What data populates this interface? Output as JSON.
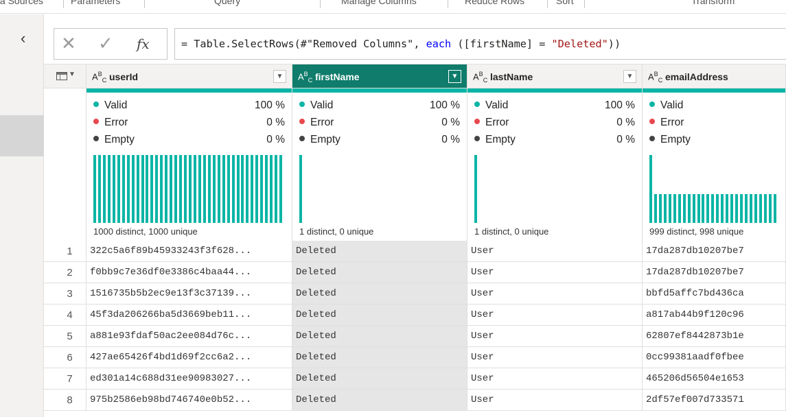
{
  "ribbon": {
    "groups": [
      "ta Sources",
      "Parameters",
      "Query",
      "Manage Columns",
      "Reduce Rows",
      "Sort",
      "Transform"
    ]
  },
  "nav": {
    "collapse_icon": "chevron-left-icon"
  },
  "formula_bar": {
    "cancel_icon": "close-icon",
    "commit_icon": "check-icon",
    "fx_label": "fx",
    "formula_prefix": "= Table.SelectRows(#\"Removed Columns\", ",
    "formula_keyword": "each",
    "formula_mid": " ([firstName] = ",
    "formula_string": "\"Deleted\"",
    "formula_suffix": "))"
  },
  "colors": {
    "accent": "#0bb5a6",
    "selected_header": "#107c6b",
    "error": "#e8484d",
    "empty": "#444444"
  },
  "columns": [
    {
      "name": "userId",
      "type_label": "ABC",
      "selected": false,
      "profile": {
        "valid_label": "Valid",
        "valid_pct": "100 %",
        "error_label": "Error",
        "error_pct": "0 %",
        "empty_label": "Empty",
        "empty_pct": "0 %",
        "distinct": "1000 distinct, 1000 unique"
      }
    },
    {
      "name": "firstName",
      "type_label": "ABC",
      "selected": true,
      "profile": {
        "valid_label": "Valid",
        "valid_pct": "100 %",
        "error_label": "Error",
        "error_pct": "0 %",
        "empty_label": "Empty",
        "empty_pct": "0 %",
        "distinct": "1 distinct, 0 unique"
      }
    },
    {
      "name": "lastName",
      "type_label": "ABC",
      "selected": false,
      "profile": {
        "valid_label": "Valid",
        "valid_pct": "100 %",
        "error_label": "Error",
        "error_pct": "0 %",
        "empty_label": "Empty",
        "empty_pct": "0 %",
        "distinct": "1 distinct, 0 unique"
      }
    },
    {
      "name": "emailAddress",
      "type_label": "ABC",
      "selected": false,
      "profile": {
        "valid_label": "Valid",
        "valid_pct": "",
        "error_label": "Error",
        "error_pct": "",
        "empty_label": "Empty",
        "empty_pct": "",
        "distinct": "999 distinct, 998 unique"
      }
    }
  ],
  "rows": [
    {
      "n": "1",
      "userId": "322c5a6f89b45933243f3f628...",
      "firstName": "Deleted",
      "lastName": "User",
      "emailAddress": "17da287db10207be7"
    },
    {
      "n": "2",
      "userId": "f0bb9c7e36df0e3386c4baa44...",
      "firstName": "Deleted",
      "lastName": "User",
      "emailAddress": "17da287db10207be7"
    },
    {
      "n": "3",
      "userId": "1516735b5b2ec9e13f3c37139...",
      "firstName": "Deleted",
      "lastName": "User",
      "emailAddress": "bbfd5affc7bd436ca"
    },
    {
      "n": "4",
      "userId": "45f3da206266ba5d3669beb11...",
      "firstName": "Deleted",
      "lastName": "User",
      "emailAddress": "a817ab44b9f120c96"
    },
    {
      "n": "5",
      "userId": "a881e93fdaf50ac2ee084d76c...",
      "firstName": "Deleted",
      "lastName": "User",
      "emailAddress": "62807ef8442873b1e"
    },
    {
      "n": "6",
      "userId": "427ae65426f4bd1d69f2cc6a2...",
      "firstName": "Deleted",
      "lastName": "User",
      "emailAddress": "0cc99381aadf0fbee"
    },
    {
      "n": "7",
      "userId": "ed301a14c688d31ee90983027...",
      "firstName": "Deleted",
      "lastName": "User",
      "emailAddress": "465206d56504e1653"
    },
    {
      "n": "8",
      "userId": "975b2586eb98bd746740e0b52...",
      "firstName": "Deleted",
      "lastName": "User",
      "emailAddress": "2df57ef007d733571"
    }
  ]
}
